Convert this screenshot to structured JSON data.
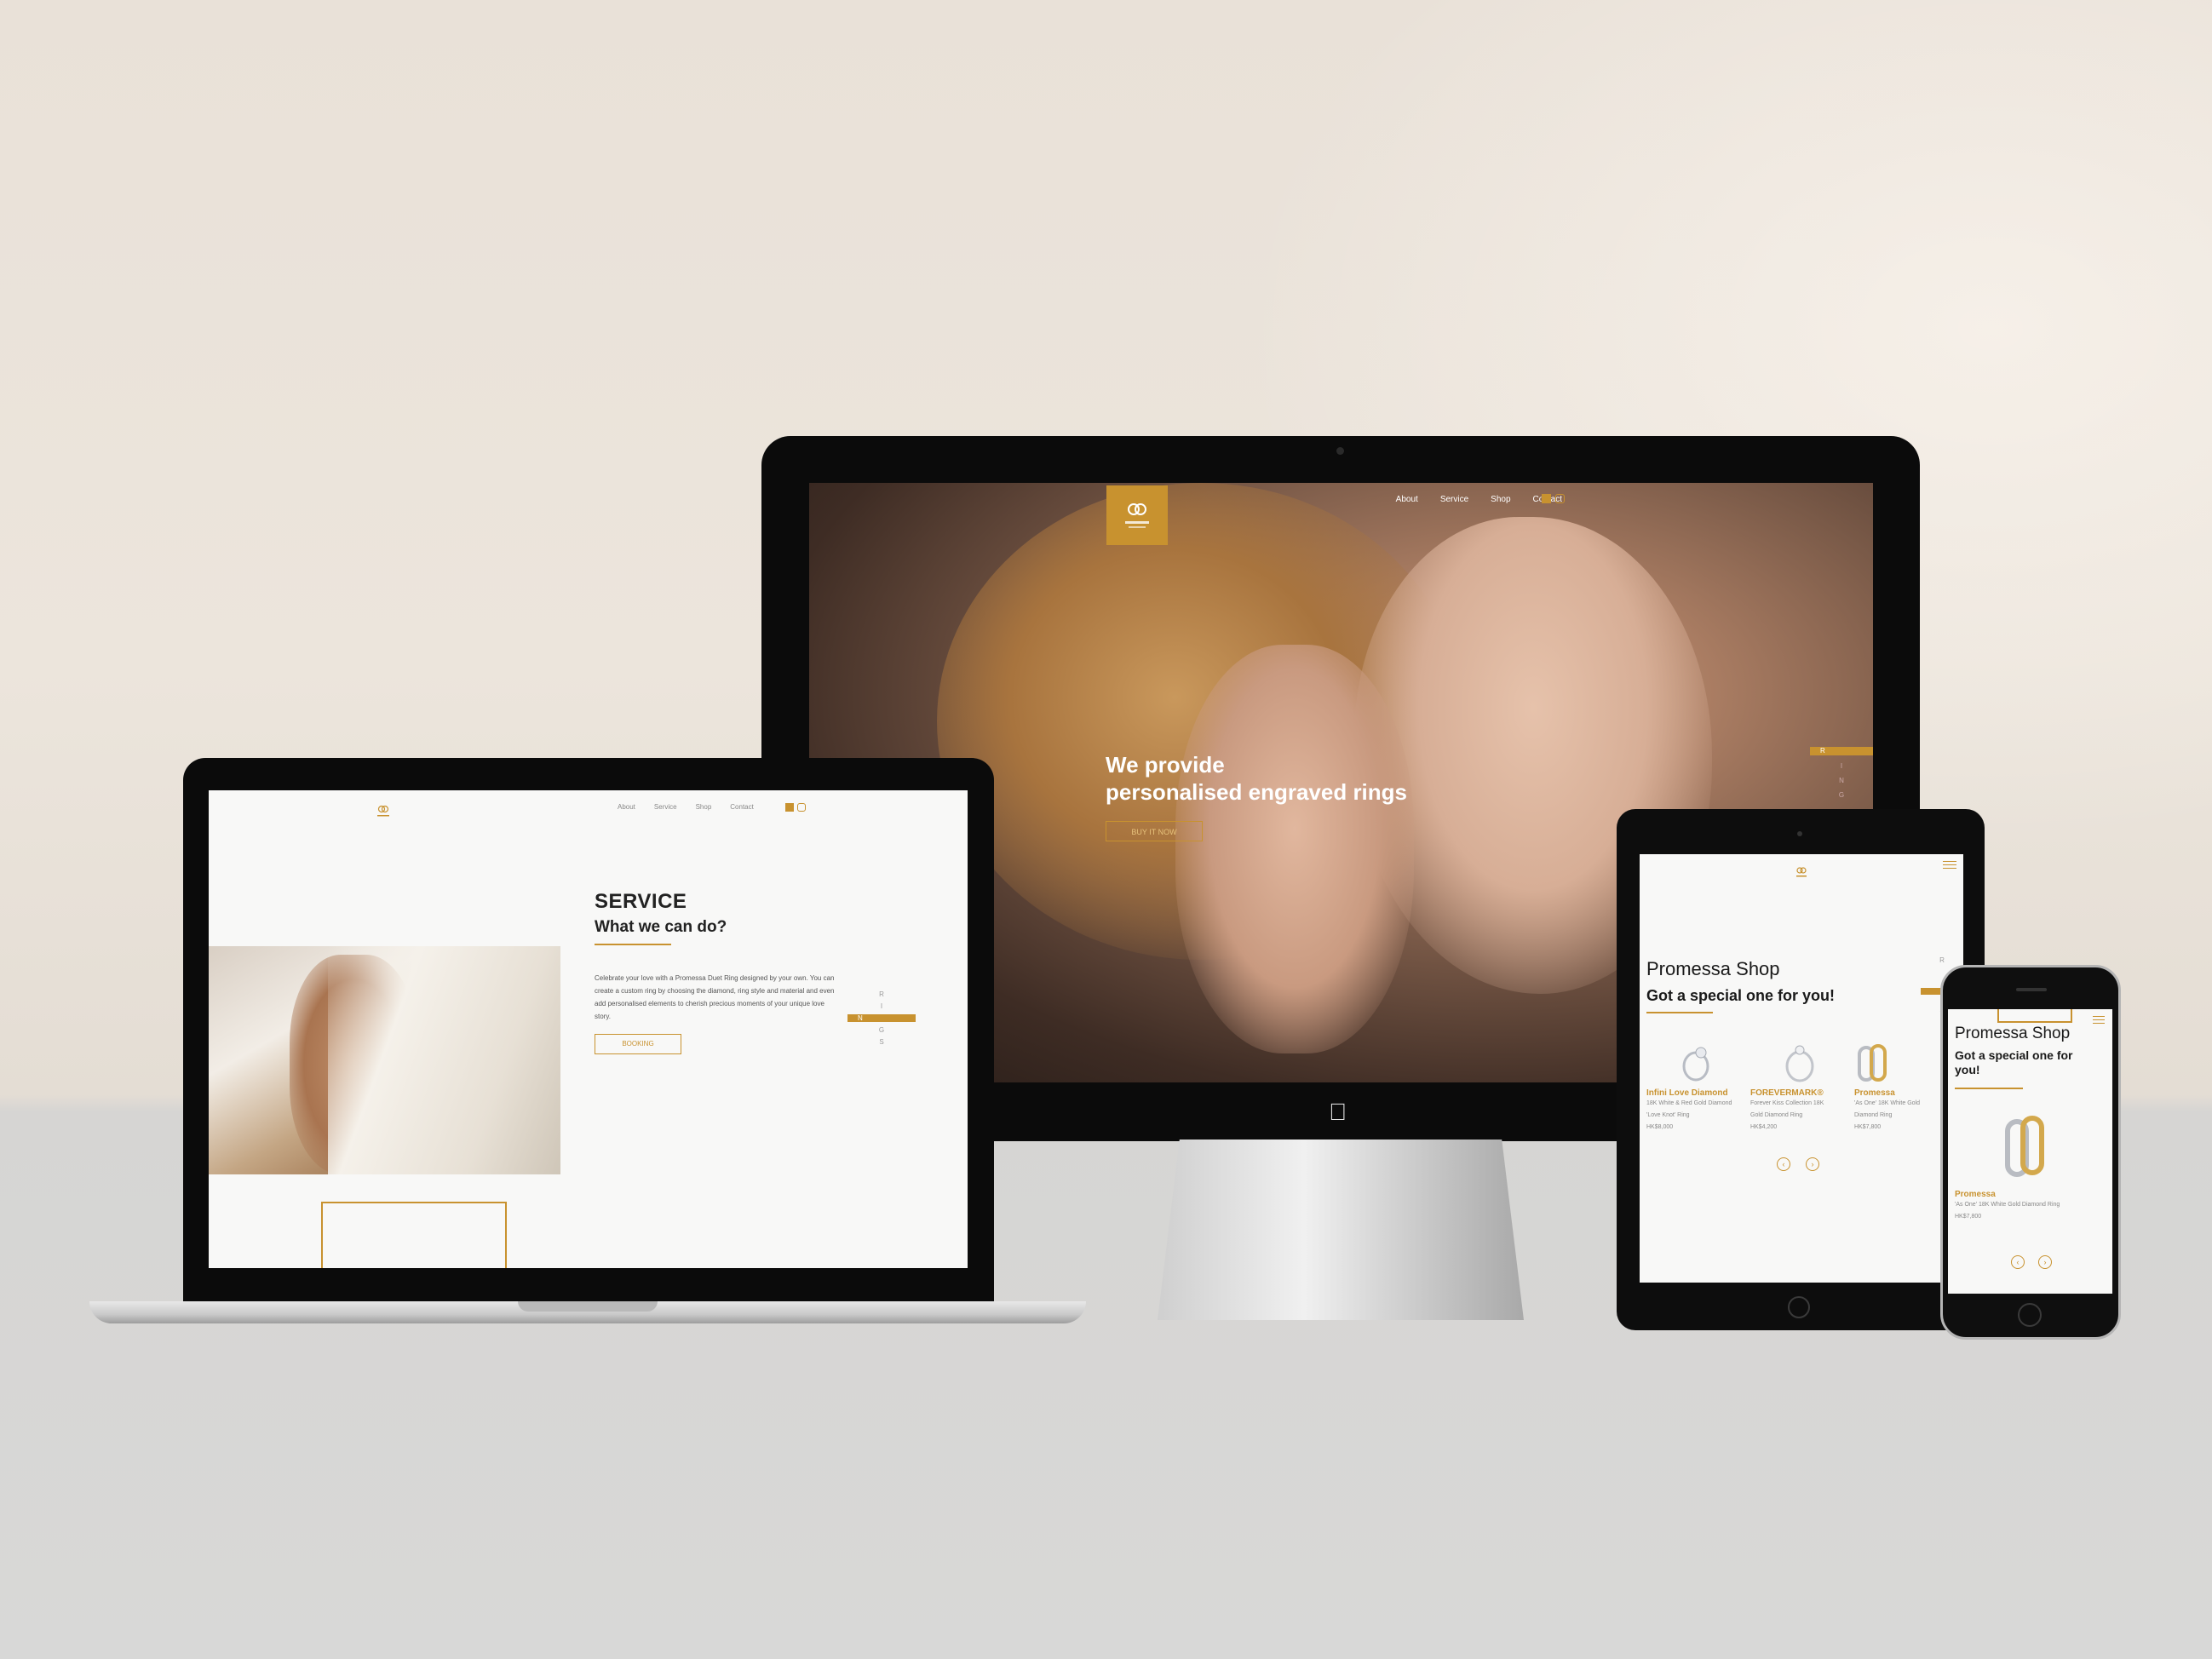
{
  "site": {
    "brand_colors": {
      "gold": "#c8922f",
      "text": "#222222",
      "background": "#f8f8f7"
    },
    "nav": {
      "items": [
        "About",
        "Service",
        "Shop",
        "Contact"
      ]
    },
    "social_icons": [
      "facebook-icon",
      "instagram-icon"
    ]
  },
  "imac": {
    "hero": {
      "title_line1": "We provide",
      "title_line2": "personalised engraved rings",
      "button_label": "BUY IT NOW"
    },
    "side_indicator": [
      "R",
      "I",
      "N",
      "G"
    ]
  },
  "macbook": {
    "section_title": "SERVICE",
    "section_subtitle": "What we can do?",
    "body_text": "Celebrate your love with a Promessa Duet Ring designed by your own. You can create a custom ring by choosing the diamond, ring style and material and even add personalised elements to cherish precious moments of your unique love story.",
    "button_label": "BOOKING",
    "side_indicator": [
      "R",
      "I",
      "N",
      "G",
      "S"
    ]
  },
  "ipad": {
    "shop_title": "Promessa Shop",
    "shop_subtitle": "Got a special one for you!",
    "products": [
      {
        "name": "Infini Love Diamond",
        "desc_line1": "18K White & Red Gold Diamond",
        "desc_line2": "'Love Knot' Ring",
        "price": "HK$8,000"
      },
      {
        "name": "FOREVERMARK®",
        "desc_line1": "Forever Kiss Collection 18K",
        "desc_line2": "Gold Diamond Ring",
        "price": "HK$4,200"
      },
      {
        "name": "Promessa",
        "desc_line1": "'As One' 18K White Gold",
        "desc_line2": "Diamond Ring",
        "price": "HK$7,800"
      }
    ],
    "side_indicator": [
      "R",
      "S"
    ]
  },
  "iphone": {
    "shop_title": "Promessa Shop",
    "shop_subtitle": "Got a special one for you!",
    "product": {
      "name": "Promessa",
      "desc": "'As One' 18K White Gold Diamond Ring",
      "price": "HK$7,800"
    }
  }
}
